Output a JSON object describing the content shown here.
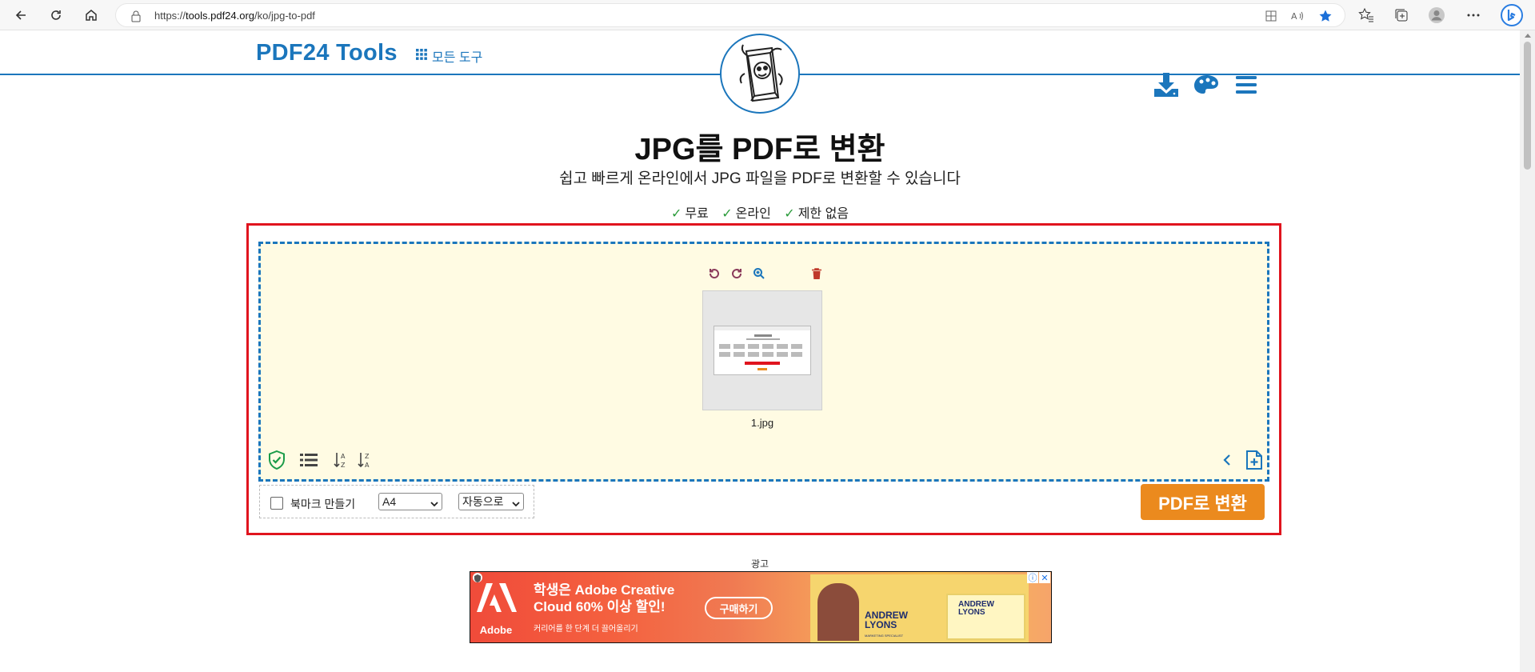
{
  "browser": {
    "url_prefix": "https://",
    "url_domain": "tools.pdf24.org",
    "url_path": "/ko/jpg-to-pdf"
  },
  "header": {
    "logo": "PDF24 Tools",
    "all_tools": "모든 도구"
  },
  "main": {
    "title": "JPG를 PDF로 변환",
    "subtitle": "쉽고 빠르게 온라인에서 JPG 파일을 PDF로 변환할 수 있습니다",
    "features": [
      "무료",
      "온라인",
      "제한 없음"
    ]
  },
  "tool": {
    "file_name": "1.jpg",
    "bookmark_label": "북마크 만들기",
    "page_size_selected": "A4",
    "orientation_selected": "자동으로",
    "convert_label": "PDF로 변환"
  },
  "ad": {
    "label": "광고",
    "brand": "Adobe",
    "headline_line1": "학생은 Adobe Creative",
    "headline_line2": "Cloud 60% 이상 할인!",
    "subline": "커리어를 한 단계 더 끌어올리기",
    "button": "구매하기",
    "person_name_line1": "ANDREW",
    "person_name_line2": "LYONS",
    "person_title": "MARKETING SPECIALIST",
    "frame_name_line1": "ANDREW",
    "frame_name_line2": "LYONS"
  },
  "colors": {
    "brand_blue": "#1b76bc",
    "highlight_red": "#e0141e",
    "convert_orange": "#eb8a1e",
    "drop_bg": "#fffbe3",
    "check_green": "#2a9b3a"
  }
}
